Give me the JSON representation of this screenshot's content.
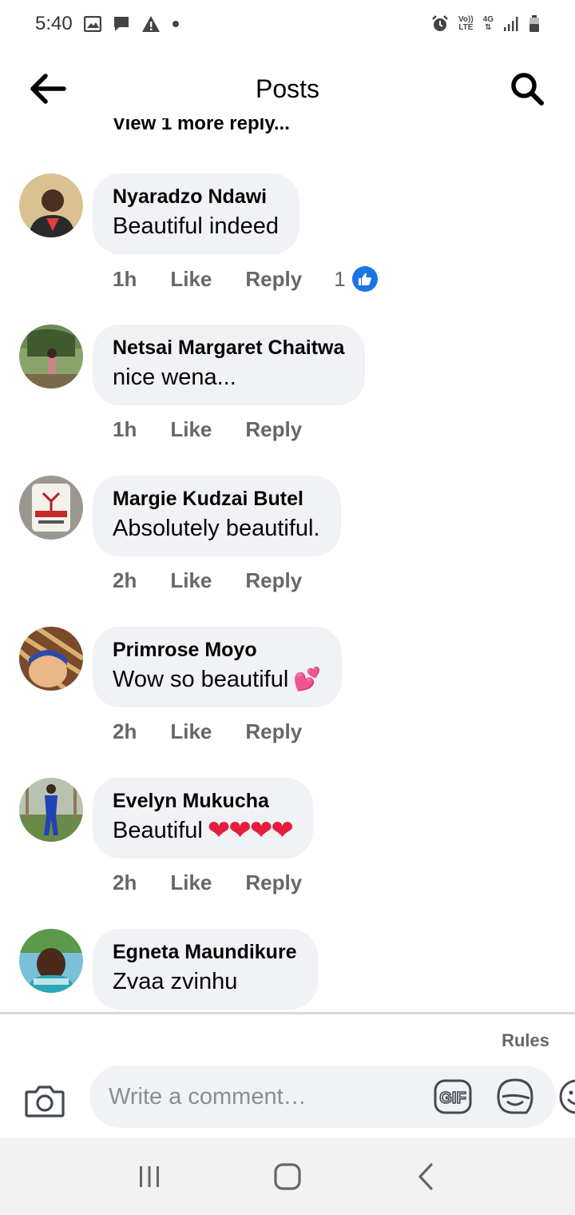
{
  "status_bar": {
    "time": "5:40",
    "network_label_top": "Vo))",
    "network_label_bottom": "LTE",
    "data_label": "4G",
    "icons": [
      "image-icon",
      "message-icon",
      "warning-icon",
      "dot-icon",
      "alarm-icon",
      "signal-icon",
      "battery-icon"
    ]
  },
  "header": {
    "title": "Posts",
    "back_icon": "arrow-left-icon",
    "search_icon": "search-icon"
  },
  "view_more": "View 1 more reply...",
  "comments": [
    {
      "author": "Nyaradzo Ndawi",
      "text": "Beautiful indeed",
      "emoji": "",
      "time": "1h",
      "like": "Like",
      "reply": "Reply",
      "reactions": "1"
    },
    {
      "author": "Netsai Margaret Chaitwa",
      "text": "nice wena...",
      "emoji": "",
      "time": "1h",
      "like": "Like",
      "reply": "Reply",
      "reactions": ""
    },
    {
      "author": "Margie Kudzai Butel",
      "text": "Absolutely beautiful.",
      "emoji": "",
      "time": "2h",
      "like": "Like",
      "reply": "Reply",
      "reactions": ""
    },
    {
      "author": "Primrose Moyo",
      "text": "Wow so beautiful",
      "emoji": "💕",
      "time": "2h",
      "like": "Like",
      "reply": "Reply",
      "reactions": ""
    },
    {
      "author": "Evelyn Mukucha",
      "text": "Beautiful",
      "emoji": "❤❤❤❤",
      "time": "2h",
      "like": "Like",
      "reply": "Reply",
      "reactions": ""
    },
    {
      "author": "Egneta Maundikure",
      "text": "Zvaa zvinhu",
      "emoji": "",
      "time": "",
      "like": "",
      "reply": "",
      "reactions": ""
    }
  ],
  "avatar_colors": [
    "#c9a97a",
    "#5a7a4a",
    "#b8b0a8",
    "#8a5a3a",
    "#7a9a6a",
    "#6ab0c8"
  ],
  "footer": {
    "rules": "Rules",
    "comment_placeholder": "Write a comment…",
    "gif_label": "GIF",
    "icons": [
      "camera-icon",
      "gif-icon",
      "sticker-icon",
      "smiley-icon"
    ]
  },
  "android_nav": {
    "icons": [
      "recents-icon",
      "home-icon",
      "back-icon"
    ]
  },
  "colors": {
    "bubble_bg": "#f0f2f5",
    "secondary_text": "#65676b",
    "like_blue": "#1b74e4",
    "heart_red": "#e41e3f"
  }
}
